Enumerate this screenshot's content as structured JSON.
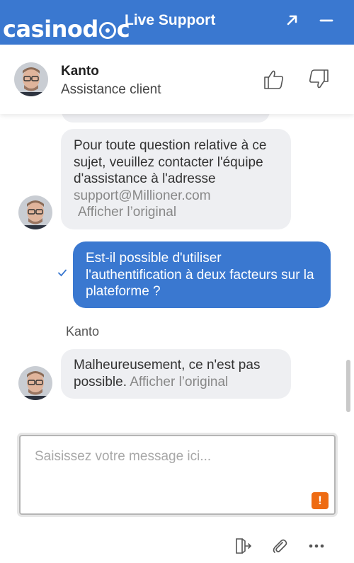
{
  "header": {
    "logo_text": "casinodoc",
    "title": "Live Support",
    "expand_icon": "arrow-up-right-icon",
    "minimize_icon": "minus-icon"
  },
  "agent": {
    "name": "Kanto",
    "role": "Assistance client",
    "rate_up_icon": "thumbs-up-icon",
    "rate_down_icon": "thumbs-down-icon"
  },
  "messages": [
    {
      "direction": "in",
      "text": "Pour toute question relative à ce sujet, veuillez contacter l'équipe d'assistance à l'adresse",
      "email": "support@Millioner.com",
      "translate_label": "Afficher l’original"
    },
    {
      "direction": "out",
      "text": "Est-il possible d'utiliser l'authentification à deux facteurs sur la plateforme ?",
      "status_icon": "check-icon"
    },
    {
      "direction": "in",
      "sender": "Kanto",
      "text": "Malheureusement, ce n'est pas possible.",
      "translate_label": "Afficher l’original"
    }
  ],
  "composer": {
    "placeholder": "Saisissez votre message ici...",
    "value": "",
    "warning_badge": "!"
  },
  "toolbar": {
    "icons": [
      "transfer-icon",
      "paperclip-icon",
      "more-icon"
    ]
  },
  "colors": {
    "brand": "#3a78d0",
    "bubble_in": "#eeeff2",
    "warning": "#ee6b12"
  }
}
